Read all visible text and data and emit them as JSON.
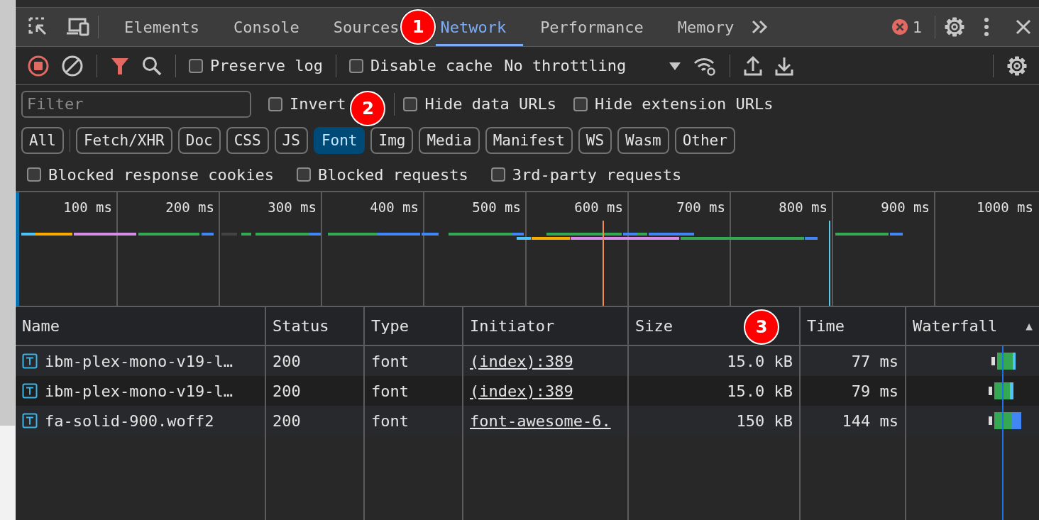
{
  "tabs": [
    {
      "label": "Elements",
      "selected": false
    },
    {
      "label": "Console",
      "selected": false
    },
    {
      "label": "Sources",
      "selected": false,
      "callout": "1"
    },
    {
      "label": "Network",
      "selected": true
    },
    {
      "label": "Performance",
      "selected": false
    },
    {
      "label": "Memory",
      "selected": false
    }
  ],
  "error_count": "1",
  "toolbar": {
    "preserve_log": {
      "label": "Preserve log",
      "checked": false
    },
    "disable_cache": {
      "label": "Disable cache",
      "checked": false
    },
    "throttling": "No throttling"
  },
  "filter": {
    "placeholder": "Filter"
  },
  "filter_options": [
    {
      "label": "Invert",
      "checked": false,
      "callout": "2"
    },
    {
      "label": "Hide data URLs",
      "checked": false
    },
    {
      "label": "Hide extension URLs",
      "checked": false
    }
  ],
  "type_filters": [
    {
      "label": "All",
      "selected": false
    },
    {
      "label": "Fetch/XHR",
      "selected": false
    },
    {
      "label": "Doc",
      "selected": false
    },
    {
      "label": "CSS",
      "selected": false
    },
    {
      "label": "JS",
      "selected": false
    },
    {
      "label": "Font",
      "selected": true
    },
    {
      "label": "Img",
      "selected": false
    },
    {
      "label": "Media",
      "selected": false
    },
    {
      "label": "Manifest",
      "selected": false
    },
    {
      "label": "WS",
      "selected": false
    },
    {
      "label": "Wasm",
      "selected": false
    },
    {
      "label": "Other",
      "selected": false
    }
  ],
  "block_options": [
    {
      "label": "Blocked response cookies",
      "checked": false
    },
    {
      "label": "Blocked requests",
      "checked": false
    },
    {
      "label": "3rd-party requests",
      "checked": false
    }
  ],
  "overview": {
    "ticks": [
      "100 ms",
      "200 ms",
      "300 ms",
      "400 ms",
      "500 ms",
      "600 ms",
      "700 ms",
      "800 ms",
      "900 ms",
      "1000 ms"
    ]
  },
  "table": {
    "columns": [
      {
        "label": "Name"
      },
      {
        "label": "Status"
      },
      {
        "label": "Type"
      },
      {
        "label": "Initiator"
      },
      {
        "label": "Size",
        "callout": "3"
      },
      {
        "label": "Time"
      },
      {
        "label": "Waterfall",
        "sort_indicator": "▲"
      }
    ],
    "rows": [
      {
        "name": "ibm-plex-mono-v19-l…",
        "status": "200",
        "type": "font",
        "initiator": "(index):389",
        "size": "15.0 kB",
        "time": "77 ms"
      },
      {
        "name": "ibm-plex-mono-v19-l…",
        "status": "200",
        "type": "font",
        "initiator": "(index):389",
        "size": "15.0 kB",
        "time": "79 ms"
      },
      {
        "name": "fa-solid-900.woff2",
        "status": "200",
        "type": "font",
        "initiator": "font-awesome-6.",
        "size": "150 kB",
        "time": "144 ms"
      }
    ]
  }
}
